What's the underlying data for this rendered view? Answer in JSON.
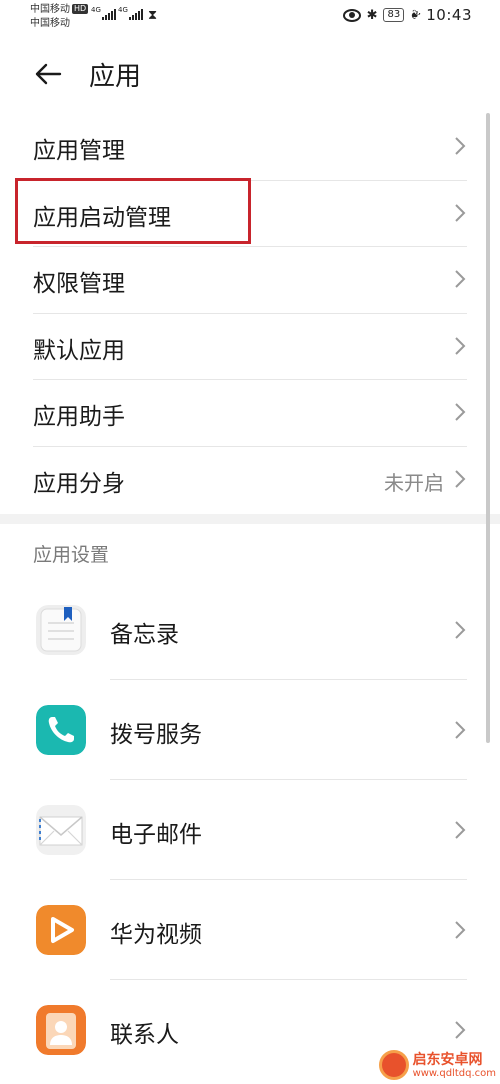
{
  "status_bar": {
    "carrier1": "中国移动",
    "hd_badge": "HD",
    "carrier2": "中国移动",
    "net1": "4G",
    "net2": "4G",
    "battery": "83",
    "time": "10:43"
  },
  "header": {
    "title": "应用"
  },
  "menu": {
    "items": [
      {
        "label": "应用管理"
      },
      {
        "label": "应用启动管理"
      },
      {
        "label": "权限管理"
      },
      {
        "label": "默认应用"
      },
      {
        "label": "应用助手"
      },
      {
        "label": "应用分身",
        "value": "未开启"
      }
    ]
  },
  "section": {
    "title": "应用设置"
  },
  "apps": [
    {
      "label": "备忘录",
      "icon": "notepad-icon",
      "color": "#eeeeee"
    },
    {
      "label": "拨号服务",
      "icon": "phone-icon",
      "color": "#1bb8b0"
    },
    {
      "label": "电子邮件",
      "icon": "envelope-icon",
      "color": "#f0f0f0"
    },
    {
      "label": "华为视频",
      "icon": "play-icon",
      "color": "#f08a2c"
    },
    {
      "label": "联系人",
      "icon": "contact-icon",
      "color": "#f07a2c"
    }
  ],
  "watermark": {
    "text": "启东安卓网",
    "url": "www.qdltdq.com"
  },
  "colors": {
    "highlight": "#c8242c",
    "divider": "#e6e6e6"
  }
}
